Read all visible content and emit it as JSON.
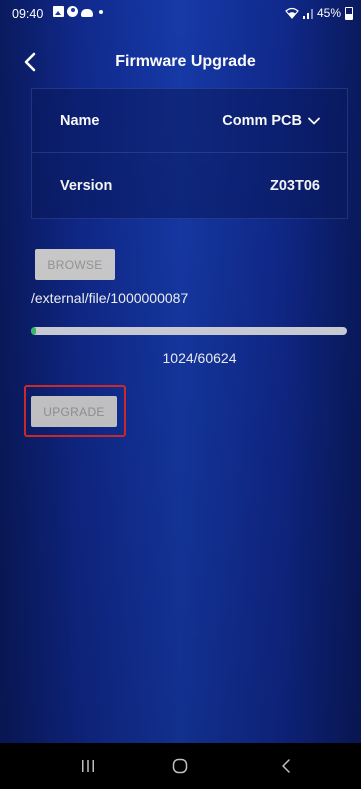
{
  "status_bar": {
    "time": "09:40",
    "battery": "45%"
  },
  "header": {
    "title": "Firmware Upgrade"
  },
  "info": {
    "name_label": "Name",
    "name_value": "Comm PCB",
    "version_label": "Version",
    "version_value": "Z03T06"
  },
  "browse": {
    "label": "BROWSE"
  },
  "file": {
    "path": "/external/file/1000000087"
  },
  "progress": {
    "current": 1024,
    "total": 60624,
    "text": "1024/60624",
    "fraction": 0.0169
  },
  "upgrade": {
    "label": "UPGRADE"
  },
  "colors": {
    "background": "#163aa8",
    "progress_fill": "#37c96b",
    "highlight": "#e02d2d",
    "button_disabled": "#d4d4d4"
  }
}
